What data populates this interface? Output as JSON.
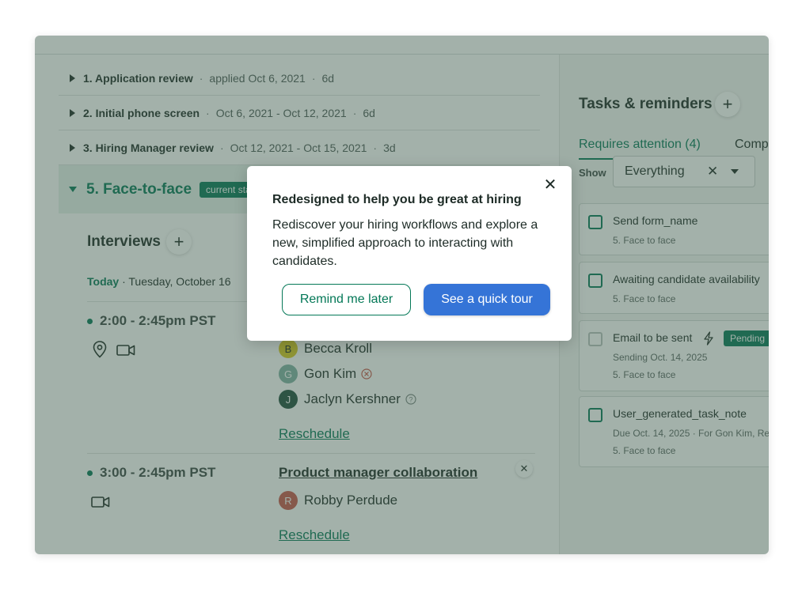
{
  "stages": [
    {
      "name": "1. Application review",
      "meta": "applied Oct 6, 2021",
      "duration": "6d"
    },
    {
      "name": "2. Initial phone screen",
      "meta": "Oct 6, 2021 - Oct 12, 2021",
      "duration": "6d"
    },
    {
      "name": "3. Hiring Manager review",
      "meta": "Oct 12, 2021 - Oct 15, 2021",
      "duration": "3d"
    }
  ],
  "active_stage": {
    "name": "5. Face-to-face",
    "badge": "current stage"
  },
  "interviews": {
    "title": "Interviews",
    "today_label": "Today",
    "date": "· Tuesday, October 16",
    "slots": [
      {
        "time": "2:00 - 2:45pm PST",
        "people": [
          {
            "initial": "B",
            "name": "Becca Kroll",
            "color": "#d8c91f"
          },
          {
            "initial": "G",
            "name": "Gon Kim",
            "color": "#7fb1a3"
          },
          {
            "initial": "J",
            "name": "Jaclyn Kershner",
            "color": "#1f4d3c"
          }
        ],
        "action": "Reschedule"
      },
      {
        "time": "3:00 - 2:45pm PST",
        "title": "Product manager collaboration",
        "people": [
          {
            "initial": "R",
            "name": "Robby Perdude",
            "color": "#c7564a"
          }
        ],
        "action": "Reschedule"
      }
    ]
  },
  "side": {
    "title": "Tasks & reminders",
    "tabs": [
      "Requires attention (4)",
      "Comp"
    ],
    "show_label": "Show",
    "filter_value": "Everything",
    "tasks": [
      {
        "title": "Send form_name",
        "sub1": "5. Face to face"
      },
      {
        "title": "Awaiting candidate availability",
        "sub1": "5. Face to face"
      },
      {
        "title": "Email to be sent",
        "badge": "Pending",
        "sub1": "Sending Oct. 14, 2025",
        "sub2": "5. Face to face"
      },
      {
        "title": "User_generated_task_note",
        "sub1": "Due Oct. 14, 2025  ·  For Gon Kim, Re",
        "sub2": "5. Face to face"
      }
    ]
  },
  "modal": {
    "title": "Redesigned to help you be great at hiring",
    "body": "Rediscover your  hiring workflows and explore a new, simplified approach to interacting with candidates.",
    "secondary_label": "Remind me later",
    "primary_label": "See a quick tour"
  },
  "colors": {
    "accent": "#047857",
    "primary": "#3574d7"
  }
}
